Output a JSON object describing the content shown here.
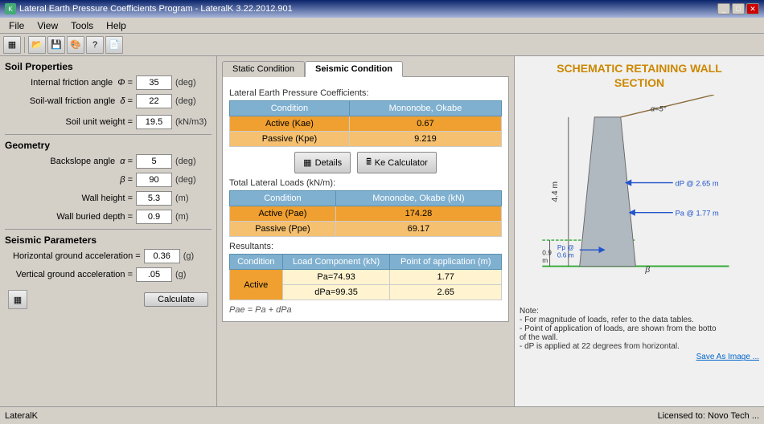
{
  "app": {
    "title": "Lateral Earth Pressure Coefficients Program - LateralK 3.22.2012.901",
    "icon": "K"
  },
  "menu": {
    "items": [
      "File",
      "View",
      "Tools",
      "Help"
    ]
  },
  "toolbar": {
    "icons": [
      "grid-icon",
      "open-icon",
      "save-icon",
      "color-icon",
      "help-icon",
      "export-icon"
    ]
  },
  "left_panel": {
    "soil_properties_title": "Soil Properties",
    "fields": [
      {
        "label": "Internal friction angle  Φ =",
        "value": "35",
        "unit": "(deg)"
      },
      {
        "label": "Soil-wall friction angle  δ =",
        "value": "22",
        "unit": "(deg)"
      },
      {
        "label": "Soil unit weight =",
        "value": "19.5",
        "unit": "(kN/m3)"
      }
    ],
    "geometry_title": "Geometry",
    "geometry_fields": [
      {
        "label": "Backslope angle  α =",
        "value": "5",
        "unit": "(deg)"
      },
      {
        "label": "β =",
        "value": "90",
        "unit": "(deg)"
      },
      {
        "label": "Wall height =",
        "value": "5.3",
        "unit": "(m)"
      },
      {
        "label": "Wall buried depth =",
        "value": "0.9",
        "unit": "(m)"
      }
    ],
    "seismic_title": "Seismic Parameters",
    "seismic_fields": [
      {
        "label": "Horizontal ground acceleration =",
        "value": "0.36",
        "unit": "(g)"
      },
      {
        "label": "Vertical ground acceleration =",
        "value": ".05",
        "unit": "(g)"
      }
    ]
  },
  "center_panel": {
    "tabs": [
      {
        "label": "Static Condition",
        "active": false
      },
      {
        "label": "Seismic Condition",
        "active": true
      }
    ],
    "coefficients_title": "Lateral Earth Pressure Coefficients:",
    "coefficients_table": {
      "headers": [
        "Condition",
        "Mononobe, Okabe"
      ],
      "rows": [
        {
          "label": "Active (Kae)",
          "value": "0.67",
          "style": "orange"
        },
        {
          "label": "Passive (Kpe)",
          "value": "9.219",
          "style": "orange-light"
        }
      ]
    },
    "buttons": [
      {
        "label": "Details",
        "icon": "table-icon"
      },
      {
        "label": "Ke Calculator",
        "icon": "calc-icon"
      }
    ],
    "loads_title": "Total Lateral Loads (kN/m):",
    "loads_table": {
      "headers": [
        "Condition",
        "Mononobe, Okabe (kN)"
      ],
      "rows": [
        {
          "label": "Active (Pae)",
          "value": "174.28",
          "style": "orange"
        },
        {
          "label": "Passive (Ppe)",
          "value": "69.17",
          "style": "orange-light"
        }
      ]
    },
    "resultants_title": "Resultants:",
    "resultants_table": {
      "headers": [
        "Condition",
        "Load Component (kN)",
        "Point of application (m)"
      ],
      "rows": [
        {
          "label": "Active",
          "sub1_label": "Pa=74.93",
          "sub1_value": "1.77",
          "sub2_label": "dPa=99.35",
          "sub2_value": "2.65"
        }
      ]
    },
    "pae_note": "Pae = Pa + dPa"
  },
  "right_panel": {
    "title_line1": "SCHEMATIC RETAINING WALL",
    "title_line2": "SECTION",
    "schematic": {
      "height_label": "4.4 m",
      "depth_label": "0.9 m",
      "alpha_label": "α=5°",
      "dp_label": "dP @ 2.65 m",
      "pa_label": "Pa @ 1.77 m",
      "pp_label": "Pp @",
      "pp_sub": "0.6 m",
      "beta_label": "β"
    },
    "notes": {
      "title": "Note:",
      "lines": [
        "- For magnitude of loads, refer to the data tables.",
        "- Point of application of loads, are shown from the botto",
        "  of the wall.",
        "- dP is applied at 22 degrees from horizontal."
      ]
    },
    "save_link": "Save As Image ..."
  },
  "status_bar": {
    "left": "LateralK",
    "right": "Licensed to: Novo Tech ..."
  },
  "colors": {
    "orange_header": "#f0a030",
    "blue_header": "#7fb0d0",
    "title_orange": "#cc8800"
  }
}
